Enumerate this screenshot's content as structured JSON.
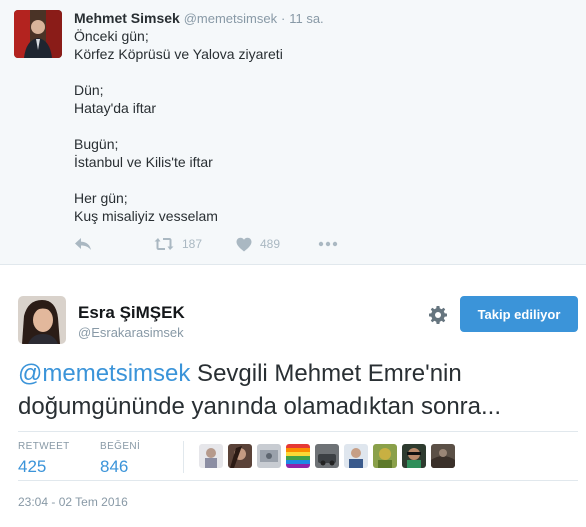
{
  "parent_tweet": {
    "fullname": "Mehmet Simsek",
    "handle": "@memetsimsek",
    "separator": "·",
    "time": "11 sa.",
    "lines": [
      "Önceki gün;",
      "Körfez Köprüsü ve Yalova ziyareti",
      "",
      "Dün;",
      "Hatay'da iftar",
      "",
      "Bugün;",
      "İstanbul ve Kilis'te iftar",
      "",
      "Her gün;",
      "Kuş misaliyiz vesselam"
    ],
    "actions": {
      "reply_icon": "reply-icon",
      "retweet_icon": "retweet-icon",
      "retweet_count": "187",
      "like_icon": "heart-icon",
      "like_count": "489",
      "more_icon": "more-icon"
    }
  },
  "tweet": {
    "fullname": "Esra ŞiMŞEK",
    "handle": "@Esrakarasimsek",
    "follow_button": "Takip ediliyor",
    "settings_icon": "gear-icon",
    "mention": "@memetsimsek",
    "text": " Sevgili Mehmet Emre'nin doğumgününde yanında olamadıktan sonra...",
    "stats": {
      "retweet_label": "RETWEET",
      "retweet_count": "425",
      "like_label": "BEĞENİ",
      "like_count": "846"
    },
    "liker_count_shown": 9,
    "timestamp": "23:04 - 02 Tem 2016"
  },
  "colors": {
    "accent": "#3b94d9",
    "muted": "#8899a6",
    "text": "#292f33",
    "parent_bg": "#f5f8fa",
    "divider": "#e1e8ed"
  }
}
